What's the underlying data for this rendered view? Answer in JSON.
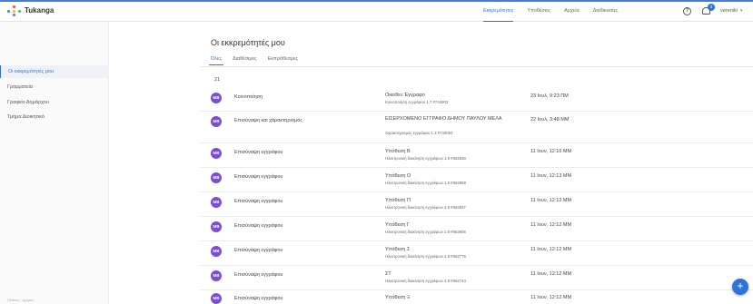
{
  "app": {
    "logo_text": "Tukanga"
  },
  "nav": {
    "items": [
      {
        "label": "Εκκρεμότητες",
        "active": true
      },
      {
        "label": "Υποθέσεις",
        "active": false
      },
      {
        "label": "Αρχεία",
        "active": false
      },
      {
        "label": "Διαδικασίες",
        "active": false
      }
    ]
  },
  "topbar": {
    "help_glyph": "?",
    "notification_count": "3",
    "user_name": "vereniki",
    "chevron": "▾"
  },
  "sidebar": {
    "items": [
      {
        "label": "Οι εκκρεμότητές μου",
        "active": true
      },
      {
        "label": "Γραμματεία",
        "active": false
      },
      {
        "label": "Γραφείο Δημάρχου",
        "active": false
      },
      {
        "label": "Τμήμα Διοικητικό",
        "active": false
      }
    ],
    "footer": "Πλάνος - Αρχική"
  },
  "main": {
    "title": "Οι εκκρεμότητές μου",
    "tabs": [
      {
        "label": "Όλες",
        "active": true
      },
      {
        "label": "Διαθέσιμες",
        "active": false
      },
      {
        "label": "Εκπρόθεσμες",
        "active": false
      }
    ],
    "count": "21"
  },
  "rows": [
    {
      "initials": "MB",
      "action": "Κοινοποίηση",
      "doc_title": "Οικοθεν Έγγραφο",
      "doc_sub": "Κοινοποίηση εγγράφου  1.7  #744903",
      "date": "23 Ιουλ, 9:23 ΠΜ"
    },
    {
      "initials": "MB",
      "action": "Επισύναψη και χαρακτηρισμός",
      "doc_title": "ΕΙΣΕΡΧΟΜΕΝΟ ΕΓΓΡΑΦΟ ΔΗΜΟΥ ΠΑΥΛΟΥ ΜΕΛΑ",
      "doc_sub": "Χαρακτηρισμός εγγράφου  1.3  #743053",
      "date": "22 Ιουλ, 3:48 ΜΜ"
    },
    {
      "initials": "MB",
      "action": "Επισύναψη εγγράφου",
      "doc_title": "Υπόθεση Β",
      "doc_sub": "Ηλεκτρονική διακίνηση εγγράφων  1.9  #662930",
      "date": "11 Ιουν, 12:16 ΜΜ"
    },
    {
      "initials": "MB",
      "action": "Επισύναψη εγγράφου",
      "doc_title": "Υπόθεση Ο",
      "doc_sub": "Ηλεκτρονική διακίνηση εγγράφων  1.9  #662868",
      "date": "11 Ιουν, 12:13 ΜΜ"
    },
    {
      "initials": "MB",
      "action": "Επισύναψη εγγράφου",
      "doc_title": "Υπόθεση Π",
      "doc_sub": "Ηλεκτρονική διακίνηση εγγράφων  1.9  #662837",
      "date": "11 Ιουν, 12:13 ΜΜ"
    },
    {
      "initials": "MB",
      "action": "Επισύναψη εγγράφου",
      "doc_title": "Υπόθεση Γ",
      "doc_sub": "Ηλεκτρονική διακίνηση εγγράφων  1.9  #662806",
      "date": "11 Ιουν, 12:12 ΜΜ"
    },
    {
      "initials": "MB",
      "action": "Επισύναψη εγγράφου",
      "doc_title": "Υπόθεση Σ",
      "doc_sub": "Ηλεκτρονική διακίνηση εγγράφων  1.9  #662775",
      "date": "11 Ιουν, 12:12 ΜΜ"
    },
    {
      "initials": "MB",
      "action": "Επισύναψη εγγράφου",
      "doc_title": "ΣΤ",
      "doc_sub": "Ηλεκτρονική διακίνηση εγγράφων  1.9  #662744",
      "date": "11 Ιουν, 12:12 ΜΜ"
    },
    {
      "initials": "MB",
      "action": "Επισύναψη εγγράφου",
      "doc_title": "Υπόθεση Ξ",
      "doc_sub": "",
      "date": "11 Ιουν, 12:12 ΜΜ"
    }
  ],
  "fab": {
    "label": "+"
  },
  "colors": {
    "accent": "#2f73d8",
    "avatar": "#7c4dd6"
  }
}
